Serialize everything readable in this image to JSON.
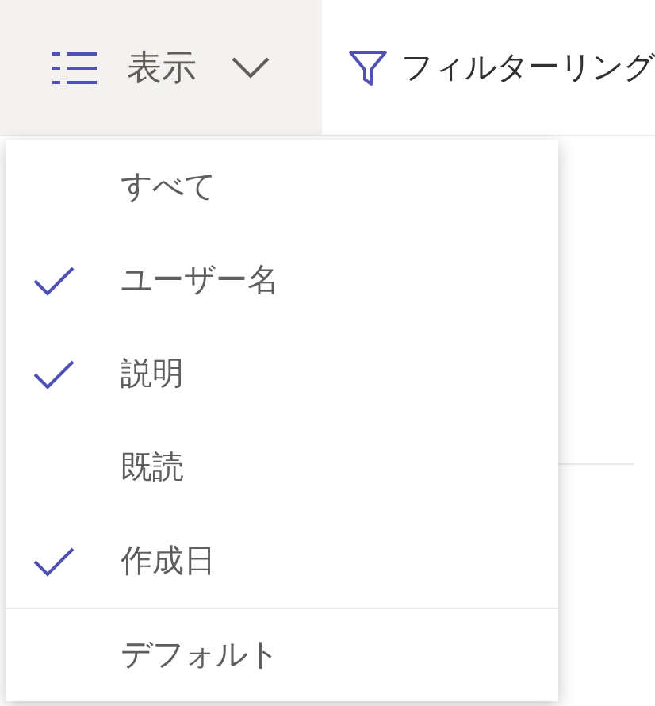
{
  "toolbar": {
    "view_button": {
      "label": "表示"
    },
    "filter_button": {
      "label": "フィルターリング"
    }
  },
  "view_menu": {
    "items": [
      {
        "label": "すべて",
        "checked": false
      },
      {
        "label": "ユーザー名",
        "checked": true
      },
      {
        "label": "説明",
        "checked": true
      },
      {
        "label": "既読",
        "checked": false
      },
      {
        "label": "作成日",
        "checked": true
      }
    ],
    "footer": "デフォルト"
  }
}
